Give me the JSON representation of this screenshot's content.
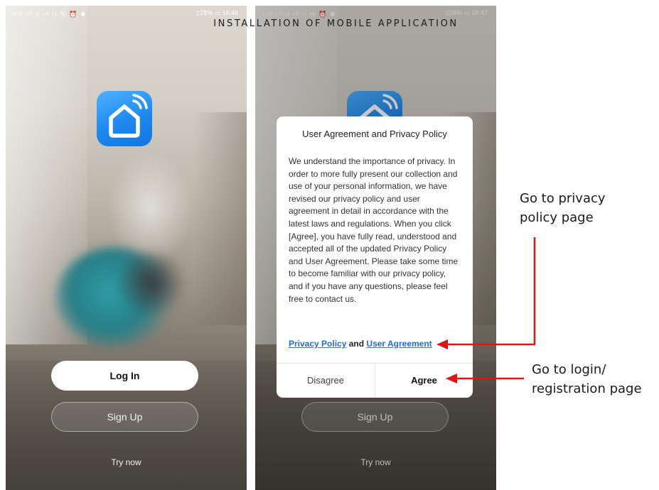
{
  "document": {
    "title": "INSTALLATION OF MOBILE APPLICATION"
  },
  "screens": {
    "left": {
      "status_left": "ᵃ⁴ᴳ ⁴ᴳ.ıl ⁴ᴳ.ıl Ⓝ ⏰ ✱",
      "status_right": "▯28% ▭ 16:46",
      "app_icon": "smart-home-icon",
      "login_label": "Log In",
      "signup_label": "Sign Up",
      "try_now_label": "Try now"
    },
    "right": {
      "status_left": "ᵃ⁴ᴳ ⁴ᴳ.ıl ⁴ᴳ.ıl Ⓝ ⏰ ✱",
      "status_right": "▯28% ▭ 16:47",
      "signup_label": "Sign Up",
      "try_now_label": "Try now",
      "dialog": {
        "title": "User Agreement and Privacy Policy",
        "body": "We understand the importance of privacy. In order to more fully present our collection and use of your personal information, we have revised our privacy policy and user agreement in detail in accordance with the latest laws and regulations. When you click [Agree], you have fully read, understood and accepted all of the updated Privacy Policy and User Agreement. Please take some time to become familiar with our privacy policy, and if you have any questions, please feel free to contact us.",
        "link_privacy": "Privacy Policy",
        "link_and": "and",
        "link_agreement": "User Agreement",
        "disagree_label": "Disagree",
        "agree_label": "Agree"
      }
    }
  },
  "annotations": {
    "privacy_line1": "Go to privacy",
    "privacy_line2": "policy page",
    "login_line1": "Go to login/",
    "login_line2": "registration page",
    "arrow_color": "#e01414"
  },
  "colors": {
    "app_icon": "#1e88f0",
    "link": "#1c6fd6"
  }
}
